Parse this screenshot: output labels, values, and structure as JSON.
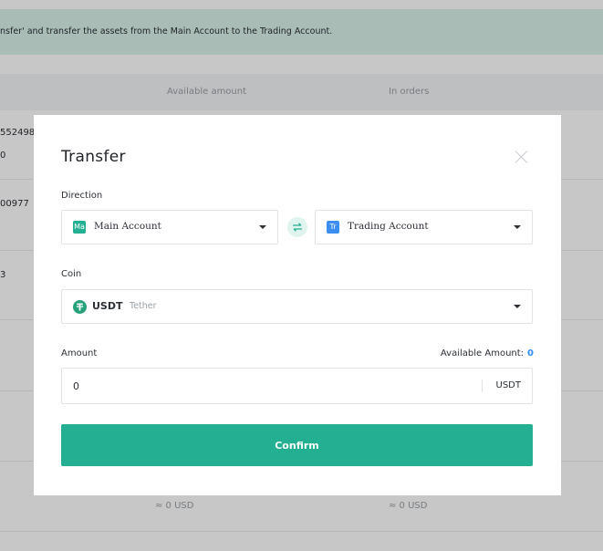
{
  "background": {
    "banner_text": "nsfer' and transfer the assets from the Main Account to the Trading Account.",
    "headers": {
      "available": "Available amount",
      "in_orders": "In orders"
    },
    "row_fragments": [
      "552498",
      "0",
      "00977",
      "3"
    ],
    "usd_values": {
      "available": "≈ 0 USD",
      "in_orders": "≈ 0 USD"
    }
  },
  "modal": {
    "title": "Transfer",
    "direction_label": "Direction",
    "from": {
      "badge": "Ma",
      "label": "Main Account",
      "badge_color": "#23af91"
    },
    "to": {
      "badge": "Tr",
      "label": "Trading Account",
      "badge_color": "#3b8df0"
    },
    "coin_label": "Coin",
    "coin": {
      "symbol": "USDT",
      "name": "Tether"
    },
    "amount_label": "Amount",
    "available_label": "Available Amount:",
    "available_value": "0",
    "amount_value": "0",
    "amount_unit": "USDT",
    "confirm_label": "Confirm"
  },
  "colors": {
    "accent": "#23af91",
    "link": "#2d8ef5"
  }
}
